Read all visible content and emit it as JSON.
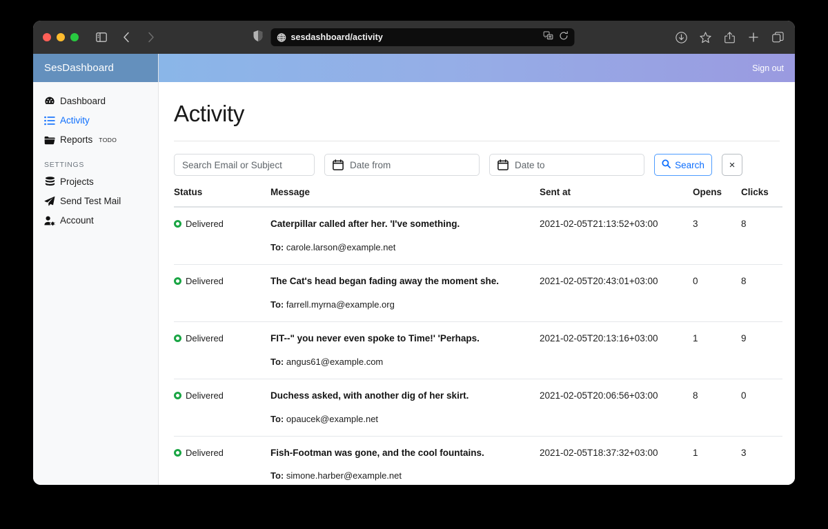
{
  "browser": {
    "url": "sesdashboard/activity",
    "icons": {
      "sidebar_toggle": "sidebar-toggle-icon",
      "back": "back-arrow-icon",
      "forward": "forward-arrow-icon",
      "shield": "shield-icon",
      "globe": "globe-icon",
      "translate": "translate-icon",
      "reload": "reload-icon",
      "download": "download-icon",
      "bookmark": "star-icon",
      "share": "share-icon",
      "new_tab": "plus-icon",
      "tab_overview": "tab-overview-icon"
    }
  },
  "sidebar": {
    "brand": "SesDashboard",
    "items": [
      {
        "label": "Dashboard",
        "icon": "speedometer-icon",
        "active": false
      },
      {
        "label": "Activity",
        "icon": "list-icon",
        "active": true
      },
      {
        "label": "Reports",
        "icon": "folder-icon",
        "active": false,
        "badge": "TODO"
      }
    ],
    "section_label": "SETTINGS",
    "settings_items": [
      {
        "label": "Projects",
        "icon": "database-icon"
      },
      {
        "label": "Send Test Mail",
        "icon": "paper-plane-icon"
      },
      {
        "label": "Account",
        "icon": "user-gear-icon"
      }
    ]
  },
  "topbar": {
    "signout_label": "Sign out",
    "gradient_start": "#8ab6e8",
    "gradient_end": "#9a9ae0"
  },
  "page": {
    "title": "Activity"
  },
  "filters": {
    "search_placeholder": "Search Email or Subject",
    "search_value": "",
    "date_from_placeholder": "Date from",
    "date_from_value": "",
    "date_to_placeholder": "Date to",
    "date_to_value": "",
    "search_button_label": "Search",
    "clear_button_label": "×"
  },
  "table": {
    "columns": [
      "Status",
      "Message",
      "Sent at",
      "Opens",
      "Clicks"
    ],
    "to_prefix": "To:",
    "status_color": "#1aa544",
    "rows": [
      {
        "status": "Delivered",
        "subject": "Caterpillar called after her. 'I've something.",
        "to": "carole.larson@example.net",
        "sent_at": "2021-02-05T21:13:52+03:00",
        "opens": "3",
        "clicks": "8"
      },
      {
        "status": "Delivered",
        "subject": "The Cat's head began fading away the moment she.",
        "to": "farrell.myrna@example.org",
        "sent_at": "2021-02-05T20:43:01+03:00",
        "opens": "0",
        "clicks": "8"
      },
      {
        "status": "Delivered",
        "subject": "FIT--\" you never even spoke to Time!' 'Perhaps.",
        "to": "angus61@example.com",
        "sent_at": "2021-02-05T20:13:16+03:00",
        "opens": "1",
        "clicks": "9"
      },
      {
        "status": "Delivered",
        "subject": "Duchess asked, with another dig of her skirt.",
        "to": "opaucek@example.net",
        "sent_at": "2021-02-05T20:06:56+03:00",
        "opens": "8",
        "clicks": "0"
      },
      {
        "status": "Delivered",
        "subject": "Fish-Footman was gone, and the cool fountains.",
        "to": "simone.harber@example.net",
        "sent_at": "2021-02-05T18:37:32+03:00",
        "opens": "1",
        "clicks": "3"
      }
    ]
  }
}
